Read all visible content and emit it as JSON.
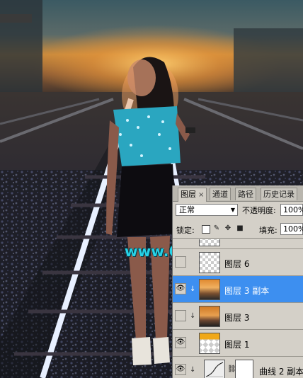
{
  "canvas": {
    "watermark": "www.68ps.com"
  },
  "layers_panel": {
    "tabs": [
      {
        "label": "图层",
        "active": true
      },
      {
        "label": "通道",
        "active": false
      },
      {
        "label": "路径",
        "active": false
      },
      {
        "label": "历史记录",
        "active": false
      }
    ],
    "tab_close": "×",
    "blend_mode": "正常",
    "opacity_label": "不透明度:",
    "opacity_value": "100%",
    "lock_label": "锁定:",
    "fill_label": "填充:",
    "fill_value": "100%",
    "layers": [
      {
        "name": "图层 6",
        "visible": false,
        "selected": false,
        "clipped": false
      },
      {
        "name": "图层 3 副本",
        "visible": true,
        "selected": true,
        "clipped": true
      },
      {
        "name": "图层 3",
        "visible": false,
        "selected": false,
        "clipped": true
      },
      {
        "name": "图层 1",
        "visible": true,
        "selected": false,
        "clipped": false
      },
      {
        "name": "曲线 2 副本",
        "visible": true,
        "selected": false,
        "clipped": true
      }
    ]
  },
  "colors": {
    "selection": "#3d8ff0",
    "panel_bg": "#d4d0c8",
    "watermark": "#27d3e8"
  }
}
